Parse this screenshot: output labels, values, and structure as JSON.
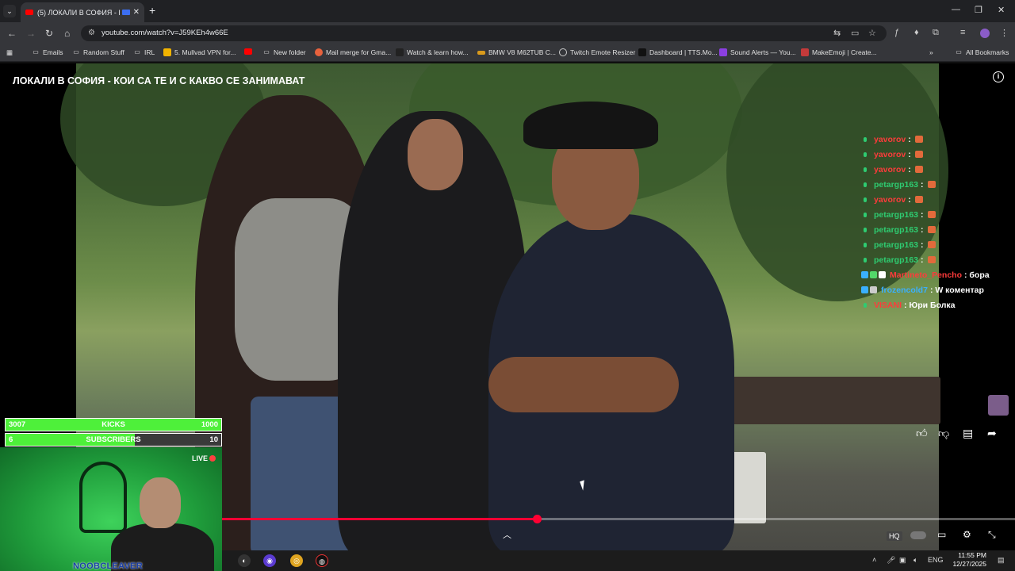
{
  "browser": {
    "tab_title": "(5) ЛОКАЛИ В СОФИЯ - КС",
    "url": "youtube.com/watch?v=J59KEh4w66E",
    "new_tab": "+",
    "tab_close": "✕"
  },
  "bookmarks": {
    "items": [
      {
        "label": "Emails",
        "icon": "folder-icon"
      },
      {
        "label": "Random Stuff",
        "icon": "folder-icon"
      },
      {
        "label": "IRL",
        "icon": "folder-icon"
      },
      {
        "label": "5. Mullvad VPN for...",
        "icon": "mullvad-icon"
      },
      {
        "label": "",
        "icon": "youtube-icon"
      },
      {
        "label": "New folder",
        "icon": "folder-icon"
      },
      {
        "label": "Mail merge for Gma...",
        "icon": "mailmerge-icon"
      },
      {
        "label": "Watch & learn how...",
        "icon": "site-icon"
      },
      {
        "label": "BMW V8 M62TUB C...",
        "icon": "site-icon"
      },
      {
        "label": "Twitch Emote Resizer",
        "icon": "globe-icon"
      },
      {
        "label": "Dashboard | TTS.Mo...",
        "icon": "site-icon"
      },
      {
        "label": "Sound Alerts — You...",
        "icon": "soundalerts-icon"
      },
      {
        "label": "MakeEmoji | Create...",
        "icon": "makeemoji-icon"
      }
    ],
    "all_bookmarks": "All Bookmarks"
  },
  "video": {
    "title": "ЛОКАЛИ В СОФИЯ - КОИ СА ТЕ И С КАКВО СЕ ЗАНИМАВАТ",
    "progress_fraction": 0.397
  },
  "chat": [
    {
      "user": "yavorov",
      "color": "#ff3b3b",
      "message": ":",
      "emote": true,
      "badges": []
    },
    {
      "user": "yavorov",
      "color": "#ff3b3b",
      "message": ":",
      "emote": true,
      "badges": []
    },
    {
      "user": "yavorov",
      "color": "#ff3b3b",
      "message": ":",
      "emote": true,
      "badges": []
    },
    {
      "user": "petargp163",
      "color": "#2ecc71",
      "message": ":",
      "emote": true,
      "badges": []
    },
    {
      "user": "yavorov",
      "color": "#ff3b3b",
      "message": ":",
      "emote": true,
      "badges": []
    },
    {
      "user": "petargp163",
      "color": "#2ecc71",
      "message": ":",
      "emote": true,
      "badges": []
    },
    {
      "user": "petargp163",
      "color": "#2ecc71",
      "message": ":",
      "emote": true,
      "badges": []
    },
    {
      "user": "petargp163",
      "color": "#2ecc71",
      "message": ":",
      "emote": true,
      "badges": []
    },
    {
      "user": "petargp163",
      "color": "#2ecc71",
      "message": ":",
      "emote": true,
      "badges": []
    },
    {
      "user": "Martineto_Pencho",
      "color": "#ff3b3b",
      "message": ": бора",
      "emote": false,
      "badges": [
        "#3ab0ff",
        "#53d769",
        "#ffffff"
      ]
    },
    {
      "user": "frozencold7",
      "color": "#3ab0ff",
      "message": ": W коментар",
      "emote": false,
      "badges": [
        "#3ab0ff",
        "#cccccc"
      ]
    },
    {
      "user": "VISANI",
      "color": "#ff3b3b",
      "message": ": Юри Болка",
      "emote": false,
      "badges": []
    }
  ],
  "goals": {
    "kicks": {
      "current": "3007",
      "label": "KICKS",
      "target": "1000",
      "fraction": 1.0
    },
    "subscribers": {
      "current": "6",
      "label": "SUBSCRIBERS",
      "target": "10",
      "fraction": 0.6
    }
  },
  "webcam": {
    "live_label": "LIVE",
    "streamer_name": "NOOBCLEAVER"
  },
  "system": {
    "language": "ENG",
    "time": "11:55 PM",
    "date": "12/27/2025"
  },
  "colors": {
    "accent_red": "#ff0033",
    "goal_green": "#4ef03a",
    "chat_green": "#2ecc71"
  }
}
